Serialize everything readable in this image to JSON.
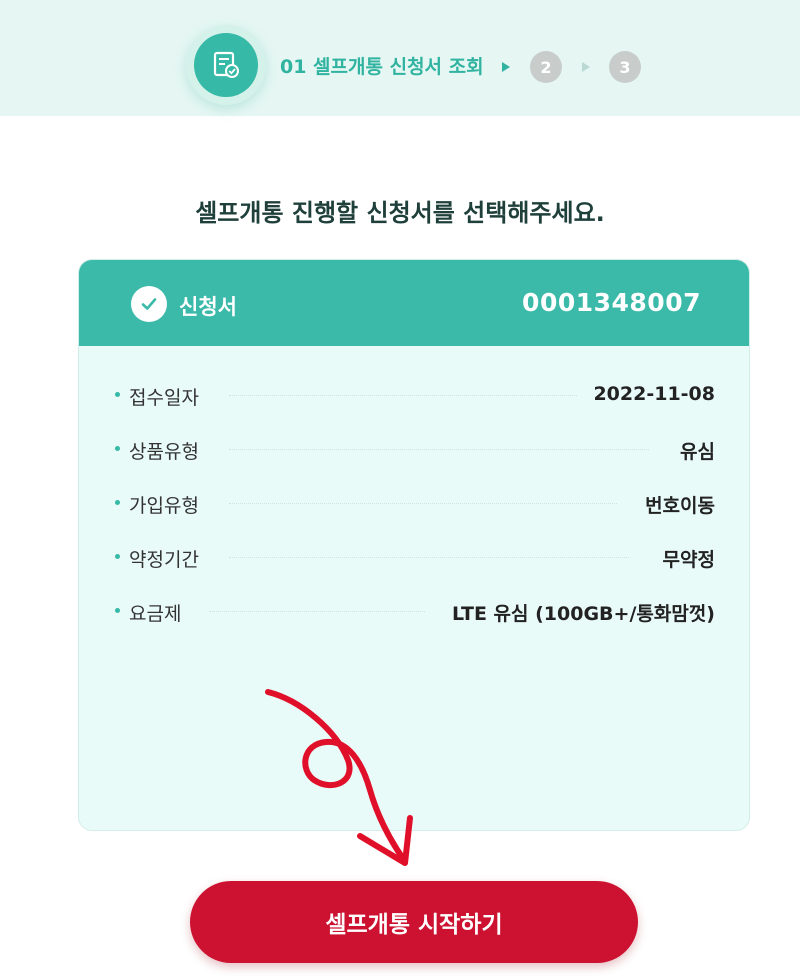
{
  "steps": {
    "current_label": "01 셀프개통 신청서 조회",
    "step2": "2",
    "step3": "3"
  },
  "page_title": "셀프개통 진행할 신청서를 선택해주세요.",
  "card": {
    "title": "신청서",
    "number": "0001348007",
    "rows": [
      {
        "label": "접수일자",
        "value": "2022-11-08"
      },
      {
        "label": "상품유형",
        "value": "유심"
      },
      {
        "label": "가입유형",
        "value": "번호이동"
      },
      {
        "label": "약정기간",
        "value": "무약정"
      },
      {
        "label": "요금제",
        "value": "LTE 유심 (100GB+/통화맘껏)"
      }
    ]
  },
  "start_button": "셀프개통 시작하기",
  "colors": {
    "accent": "#36b9a6",
    "header": "#3bbaa9",
    "button": "#cc1230",
    "annotation": "#e0102a"
  },
  "icons": {
    "step": "document-check-icon",
    "card": "check-circle-icon",
    "annotation": "red-curved-arrow-annotation"
  }
}
